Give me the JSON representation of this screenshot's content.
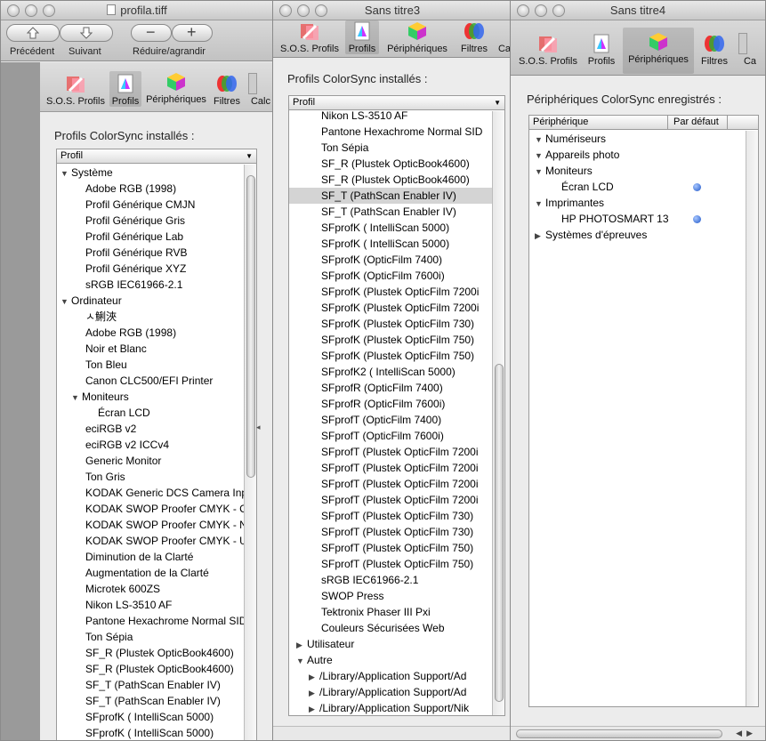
{
  "win1": {
    "title": "profila.tiff",
    "nav": {
      "prev": "Précédent",
      "next": "Suivant",
      "zoom": "Réduire/agrandir"
    },
    "tabs": [
      "S.O.S. Profils",
      "Profils",
      "Périphériques",
      "Filtres",
      "Calc"
    ],
    "section_label": "Profils ColorSync installés :",
    "column": "Profil",
    "rows": [
      {
        "t": "Système",
        "lvl": 0,
        "tri": "▼"
      },
      {
        "t": "Adobe RGB (1998)",
        "lvl": 2
      },
      {
        "t": "Profil Générique CMJN",
        "lvl": 2
      },
      {
        "t": "Profil Générique Gris",
        "lvl": 2
      },
      {
        "t": "Profil Générique Lab",
        "lvl": 2
      },
      {
        "t": "Profil Générique RVB",
        "lvl": 2
      },
      {
        "t": "Profil Générique XYZ",
        "lvl": 2
      },
      {
        "t": "sRGB IEC61966-2.1",
        "lvl": 2
      },
      {
        "t": "Ordinateur",
        "lvl": 0,
        "tri": "▼"
      },
      {
        "t": "ㅅ鯏浹",
        "lvl": 2
      },
      {
        "t": "Adobe RGB (1998)",
        "lvl": 2
      },
      {
        "t": "Noir et Blanc",
        "lvl": 2
      },
      {
        "t": "Ton Bleu",
        "lvl": 2
      },
      {
        "t": "Canon CLC500/EFI Printer",
        "lvl": 2
      },
      {
        "t": "Moniteurs",
        "lvl": 1,
        "tri": "▼"
      },
      {
        "t": "Écran LCD",
        "lvl": 3
      },
      {
        "t": "eciRGB v2",
        "lvl": 2
      },
      {
        "t": "eciRGB v2 ICCv4",
        "lvl": 2
      },
      {
        "t": "Generic Monitor",
        "lvl": 2
      },
      {
        "t": "Ton Gris",
        "lvl": 2
      },
      {
        "t": "KODAK Generic DCS Camera Inpu",
        "lvl": 2
      },
      {
        "t": "KODAK SWOP Proofer CMYK - Co",
        "lvl": 2
      },
      {
        "t": "KODAK SWOP Proofer CMYK - Ne",
        "lvl": 2
      },
      {
        "t": "KODAK SWOP Proofer CMYK - Un",
        "lvl": 2
      },
      {
        "t": "Diminution de la Clarté",
        "lvl": 2
      },
      {
        "t": "Augmentation de la Clarté",
        "lvl": 2
      },
      {
        "t": "Microtek 600ZS",
        "lvl": 2
      },
      {
        "t": "Nikon LS-3510 AF",
        "lvl": 2
      },
      {
        "t": "Pantone Hexachrome Normal SID",
        "lvl": 2
      },
      {
        "t": "Ton Sépia",
        "lvl": 2
      },
      {
        "t": "SF_R (Plustek OpticBook4600)",
        "lvl": 2
      },
      {
        "t": "SF_R (Plustek OpticBook4600)",
        "lvl": 2
      },
      {
        "t": "SF_T (PathScan Enabler IV)",
        "lvl": 2
      },
      {
        "t": "SF_T (PathScan Enabler IV)",
        "lvl": 2
      },
      {
        "t": "SFprofK ( IntelliScan 5000)",
        "lvl": 2
      },
      {
        "t": "SFprofK ( IntelliScan 5000)",
        "lvl": 2
      },
      {
        "t": "SFprofK (OpticFilm 7400)",
        "lvl": 2
      },
      {
        "t": "SFprofK (OpticFilm 7600i)",
        "lvl": 2
      }
    ]
  },
  "win2": {
    "title": "Sans titre3",
    "tabs": [
      "S.O.S. Profils",
      "Profils",
      "Périphériques",
      "Filtres",
      "Ca"
    ],
    "section_label": "Profils ColorSync installés :",
    "column": "Profil",
    "selected_index": 5,
    "rows": [
      {
        "t": "Nikon LS-3510 AF",
        "lvl": 2
      },
      {
        "t": "Pantone Hexachrome Normal SID",
        "lvl": 2
      },
      {
        "t": "Ton Sépia",
        "lvl": 2
      },
      {
        "t": "SF_R (Plustek OpticBook4600)",
        "lvl": 2
      },
      {
        "t": "SF_R (Plustek OpticBook4600)",
        "lvl": 2
      },
      {
        "t": "SF_T (PathScan Enabler IV)",
        "lvl": 2
      },
      {
        "t": "SF_T (PathScan Enabler IV)",
        "lvl": 2
      },
      {
        "t": "SFprofK ( IntelliScan 5000)",
        "lvl": 2
      },
      {
        "t": "SFprofK ( IntelliScan 5000)",
        "lvl": 2
      },
      {
        "t": "SFprofK (OpticFilm 7400)",
        "lvl": 2
      },
      {
        "t": "SFprofK (OpticFilm 7600i)",
        "lvl": 2
      },
      {
        "t": "SFprofK (Plustek OpticFilm 7200i",
        "lvl": 2
      },
      {
        "t": "SFprofK (Plustek OpticFilm 7200i",
        "lvl": 2
      },
      {
        "t": "SFprofK (Plustek OpticFilm 730)",
        "lvl": 2
      },
      {
        "t": "SFprofK (Plustek OpticFilm 750)",
        "lvl": 2
      },
      {
        "t": "SFprofK (Plustek OpticFilm 750)",
        "lvl": 2
      },
      {
        "t": "SFprofK2 ( IntelliScan 5000)",
        "lvl": 2
      },
      {
        "t": "SFprofR (OpticFilm 7400)",
        "lvl": 2
      },
      {
        "t": "SFprofR (OpticFilm 7600i)",
        "lvl": 2
      },
      {
        "t": "SFprofT (OpticFilm 7400)",
        "lvl": 2
      },
      {
        "t": "SFprofT (OpticFilm 7600i)",
        "lvl": 2
      },
      {
        "t": "SFprofT (Plustek OpticFilm 7200i",
        "lvl": 2
      },
      {
        "t": "SFprofT (Plustek OpticFilm 7200i",
        "lvl": 2
      },
      {
        "t": "SFprofT (Plustek OpticFilm 7200i",
        "lvl": 2
      },
      {
        "t": "SFprofT (Plustek OpticFilm 7200i",
        "lvl": 2
      },
      {
        "t": "SFprofT (Plustek OpticFilm 730)",
        "lvl": 2
      },
      {
        "t": "SFprofT (Plustek OpticFilm 730)",
        "lvl": 2
      },
      {
        "t": "SFprofT (Plustek OpticFilm 750)",
        "lvl": 2
      },
      {
        "t": "SFprofT (Plustek OpticFilm 750)",
        "lvl": 2
      },
      {
        "t": "sRGB IEC61966-2.1",
        "lvl": 2
      },
      {
        "t": "SWOP Press",
        "lvl": 2
      },
      {
        "t": "Tektronix Phaser III Pxi",
        "lvl": 2
      },
      {
        "t": "Couleurs Sécurisées Web",
        "lvl": 2
      },
      {
        "t": "Utilisateur",
        "lvl": 0,
        "tri": "▶"
      },
      {
        "t": "Autre",
        "lvl": 0,
        "tri": "▼"
      },
      {
        "t": "/Library/Application Support/Ad",
        "lvl": 1,
        "tri": "▶"
      },
      {
        "t": "/Library/Application Support/Ad",
        "lvl": 1,
        "tri": "▶"
      },
      {
        "t": "/Library/Application Support/Nik",
        "lvl": 1,
        "tri": "▶"
      }
    ]
  },
  "win3": {
    "title": "Sans titre4",
    "tabs": [
      "S.O.S. Profils",
      "Profils",
      "Périphériques",
      "Filtres",
      "Ca"
    ],
    "section_label": "Périphériques ColorSync enregistrés :",
    "columns": [
      "Périphérique",
      "Par défaut"
    ],
    "rows": [
      {
        "t": "Numériseurs",
        "lvl": 0,
        "tri": "▼"
      },
      {
        "t": "Appareils photo",
        "lvl": 0,
        "tri": "▼"
      },
      {
        "t": "Moniteurs",
        "lvl": 0,
        "tri": "▼"
      },
      {
        "t": "Écran LCD",
        "lvl": 2,
        "default": true
      },
      {
        "t": "Imprimantes",
        "lvl": 0,
        "tri": "▼"
      },
      {
        "t": "HP PHOTOSMART 13",
        "lvl": 2,
        "default": true
      },
      {
        "t": "Systèmes d'épreuves",
        "lvl": 0,
        "tri": "▶"
      }
    ]
  }
}
